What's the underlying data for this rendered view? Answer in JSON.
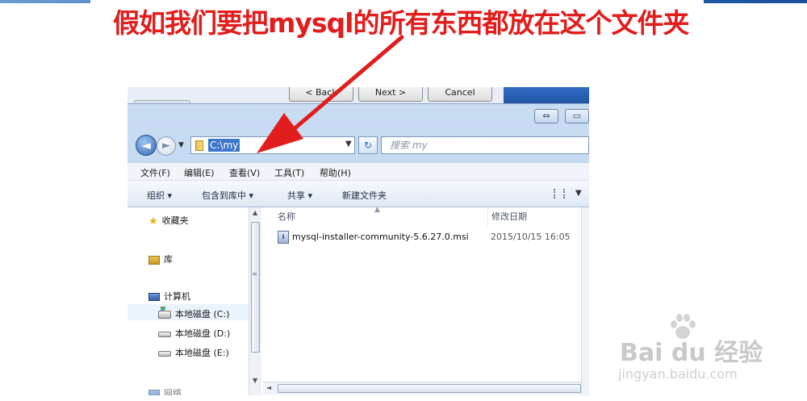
{
  "caption": "假如我们要把mysql的所有东西都放在这个文件夹",
  "wizard": {
    "back_label": "< Back",
    "next_label": "Next >",
    "cancel_label": "Cancel"
  },
  "address": {
    "path": "C:\\my",
    "search_placeholder": "搜索 my"
  },
  "menu": [
    "文件(F)",
    "编辑(E)",
    "查看(V)",
    "工具(T)",
    "帮助(H)"
  ],
  "commands": {
    "organize": "组织 ▾",
    "include_library": "包含到库中 ▾",
    "share": "共享 ▾",
    "new_folder": "新建文件夹"
  },
  "nav": {
    "favorites": "收藏夹",
    "libraries": "库",
    "computer": "计算机",
    "drive_c": "本地磁盘 (C:)",
    "drive_d": "本地磁盘 (D:)",
    "drive_e": "本地磁盘 (E:)",
    "network_partial": "网络"
  },
  "columns": {
    "name": "名称",
    "date_modified": "修改日期"
  },
  "files": [
    {
      "name": "mysql-installer-community-5.6.27.0.msi",
      "date": "2015/10/15 16:05"
    }
  ],
  "watermark": {
    "logo": "Bai du 经验",
    "url": "jingyan.baidu.com"
  },
  "colors": {
    "caption_red": "#e11d1d",
    "selection_blue": "#3c78c8"
  }
}
